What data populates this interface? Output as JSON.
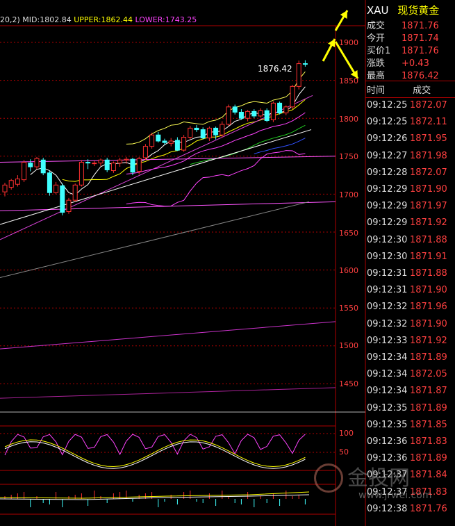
{
  "header": {
    "indicator_prefix": "20,2)",
    "mid": "MID:1802.84",
    "upper": "UPPER:1862.44",
    "lower": "LOWER:1743.25"
  },
  "chart": {
    "high_label": "1876.42",
    "y_ticks": [
      "1900",
      "1850",
      "1800",
      "1750",
      "1700",
      "1650",
      "1600",
      "1550",
      "1500",
      "1450"
    ],
    "osc_ticks": [
      "100",
      "50"
    ],
    "candles": [
      [
        1703,
        1712,
        1697,
        1715
      ],
      [
        1709,
        1718,
        1706,
        1720
      ],
      [
        1713,
        1720,
        1710,
        1725
      ],
      [
        1719,
        1742,
        1716,
        1745
      ],
      [
        1741,
        1736,
        1730,
        1746
      ],
      [
        1736,
        1747,
        1733,
        1749
      ],
      [
        1745,
        1728,
        1725,
        1748
      ],
      [
        1728,
        1702,
        1698,
        1731
      ],
      [
        1702,
        1712,
        1700,
        1716
      ],
      [
        1711,
        1676,
        1672,
        1714
      ],
      [
        1677,
        1692,
        1674,
        1695
      ],
      [
        1692,
        1712,
        1690,
        1714
      ],
      [
        1712,
        1742,
        1710,
        1745
      ],
      [
        1742,
        1741,
        1733,
        1746
      ],
      [
        1741,
        1741,
        1737,
        1744
      ],
      [
        1741,
        1745,
        1737,
        1747
      ],
      [
        1745,
        1732,
        1729,
        1748
      ],
      [
        1731,
        1741,
        1728,
        1743
      ],
      [
        1741,
        1745,
        1736,
        1748
      ],
      [
        1745,
        1746,
        1740,
        1749
      ],
      [
        1746,
        1729,
        1725,
        1748
      ],
      [
        1730,
        1747,
        1726,
        1749
      ],
      [
        1748,
        1763,
        1745,
        1766
      ],
      [
        1763,
        1778,
        1760,
        1781
      ],
      [
        1778,
        1770,
        1768,
        1782
      ],
      [
        1770,
        1768,
        1765,
        1773
      ],
      [
        1767,
        1770,
        1763,
        1774
      ],
      [
        1771,
        1758,
        1757,
        1775
      ],
      [
        1758,
        1775,
        1756,
        1778
      ],
      [
        1775,
        1787,
        1772,
        1790
      ],
      [
        1787,
        1785,
        1782,
        1791
      ],
      [
        1785,
        1774,
        1772,
        1788
      ],
      [
        1774,
        1787,
        1770,
        1789
      ],
      [
        1787,
        1778,
        1772,
        1789
      ],
      [
        1778,
        1792,
        1775,
        1796
      ],
      [
        1792,
        1815,
        1790,
        1818
      ],
      [
        1815,
        1808,
        1805,
        1818
      ],
      [
        1808,
        1800,
        1798,
        1812
      ],
      [
        1800,
        1809,
        1796,
        1811
      ],
      [
        1809,
        1803,
        1800,
        1812
      ],
      [
        1803,
        1810,
        1801,
        1813
      ],
      [
        1810,
        1797,
        1795,
        1813
      ],
      [
        1798,
        1820,
        1795,
        1822
      ],
      [
        1820,
        1807,
        1805,
        1822
      ],
      [
        1807,
        1815,
        1804,
        1817
      ],
      [
        1815,
        1842,
        1812,
        1844
      ],
      [
        1842,
        1872,
        1838,
        1876
      ],
      [
        1872,
        1871.76,
        1868,
        1876.42
      ]
    ]
  },
  "quote": {
    "symbol": "XAU",
    "name": "现货黄金",
    "rows": [
      {
        "label": "成交",
        "value": "1871.76"
      },
      {
        "label": "今开",
        "value": "1871.74"
      },
      {
        "label": "买价1",
        "value": "1871.76"
      },
      {
        "label": "涨跌",
        "value": "+0.43"
      },
      {
        "label": "最高",
        "value": "1876.42"
      }
    ]
  },
  "trades": {
    "col_time": "时间",
    "col_price": "成交",
    "rows": [
      {
        "time": "09:12:25",
        "price": "1872.07"
      },
      {
        "time": "09:12:25",
        "price": "1872.11"
      },
      {
        "time": "09:12:26",
        "price": "1871.95"
      },
      {
        "time": "09:12:27",
        "price": "1871.98"
      },
      {
        "time": "09:12:28",
        "price": "1872.07"
      },
      {
        "time": "09:12:29",
        "price": "1871.90"
      },
      {
        "time": "09:12:29",
        "price": "1871.97"
      },
      {
        "time": "09:12:29",
        "price": "1871.92"
      },
      {
        "time": "09:12:30",
        "price": "1871.88"
      },
      {
        "time": "09:12:30",
        "price": "1871.91"
      },
      {
        "time": "09:12:31",
        "price": "1871.88"
      },
      {
        "time": "09:12:31",
        "price": "1871.90"
      },
      {
        "time": "09:12:32",
        "price": "1871.96"
      },
      {
        "time": "09:12:32",
        "price": "1871.90"
      },
      {
        "time": "09:12:33",
        "price": "1871.92"
      },
      {
        "time": "09:12:34",
        "price": "1871.89"
      },
      {
        "time": "09:12:34",
        "price": "1872.05"
      },
      {
        "time": "09:12:34",
        "price": "1871.87"
      },
      {
        "time": "09:12:35",
        "price": "1871.89"
      },
      {
        "time": "09:12:35",
        "price": "1871.85"
      },
      {
        "time": "09:12:36",
        "price": "1871.83"
      },
      {
        "time": "09:12:36",
        "price": "1871.89"
      },
      {
        "time": "09:12:37",
        "price": "1871.84"
      },
      {
        "time": "09:12:37",
        "price": "1871.83"
      },
      {
        "time": "09:12:38",
        "price": "1871.76"
      }
    ]
  },
  "watermark": {
    "brand": "金投网",
    "url": "www.jrwei.com"
  },
  "colors": {
    "up": "#ff3030",
    "down": "#40ffff",
    "grid": "#b00000",
    "text": "#dddddd",
    "accent_yellow": "#ffff00",
    "lower_magenta": "#ff44ff"
  }
}
